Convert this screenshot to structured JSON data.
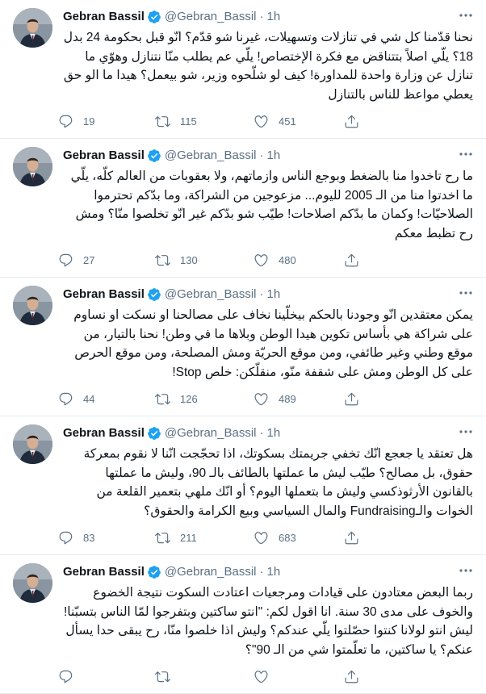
{
  "tweets": [
    {
      "name": "Gebran Bassil",
      "handle": "@Gebran_Bassil",
      "dot": "·",
      "time": "1h",
      "text": "نحنا قدّمنا كل شي في تنازلات وتسهيلات، غيرنا شو قدّم؟ انّو قبل بحكومة 24 بدل 18؟ يلّي اصلاً بتتناقض مع فكرة الإختصاص! يلّي عم يطلب منّا نتنازل وهوّي ما تنازل عن وزارة واحدة للمداورة! كيف لو شلّحوه وزير، شو بيعمل؟ هيدا ما الو حق يعطي مواعظ للناس بالتنازل",
      "replies": "19",
      "retweets": "115",
      "likes": "451"
    },
    {
      "name": "Gebran Bassil",
      "handle": "@Gebran_Bassil",
      "dot": "·",
      "time": "1h",
      "text": "ما رح تاخدوا منا بالضغط وبوجع الناس وازماتهم، ولا بعقوبات من العالم كلّه، يلّي ما اخدتوا منا من الـ 2005 لليوم... مزعوجين من الشراكة، وما بدّكم تحترموا الصلاحيّات! وكمان ما بدّكم اصلاحات! طيّب شو بدّكم غير انّو تخلصوا منّا؟ ومش رح تظبط معكم",
      "replies": "27",
      "retweets": "130",
      "likes": "480"
    },
    {
      "name": "Gebran Bassil",
      "handle": "@Gebran_Bassil",
      "dot": "·",
      "time": "1h",
      "text": "يمكن معتقدين انّو وجودنا بالحكم بيخلّينا نخاف على مصالحنا او نسكت او نساوم على شراكة هي بأساس تكوين هيدا الوطن وبلاها ما في وطن! نحنا بالتيار، من موقع وطني وغير طائفي، ومن موقع الحريّة ومش المصلحة، ومن موقع الحرص على كل الوطن ومش على شقفة منّو، منقلّكن: خلص Stop!",
      "replies": "44",
      "retweets": "126",
      "likes": "489"
    },
    {
      "name": "Gebran Bassil",
      "handle": "@Gebran_Bassil",
      "dot": "·",
      "time": "1h",
      "text": "هل تعتقد يا جعجع انّك تخفي جريمتك بسكوتك، اذا تحجّجت انّنا لا نقوم بمعركة حقوق، بل مصالح؟ طيّب ليش ما عملتها بالطائف بالـ 90، وليش ما عملتها بالقانون الأرثوذكسي وليش ما بتعملها اليوم؟ أو انّك ملهي بتعمير القلعة من الخوات والـFundraising والمال السياسي وبيع الكرامة والحقوق؟",
      "replies": "83",
      "retweets": "211",
      "likes": "683"
    },
    {
      "name": "Gebran Bassil",
      "handle": "@Gebran_Bassil",
      "dot": "·",
      "time": "1h",
      "text": "ربما البعض معتادون على قيادات ومرجعيات اعتادت السكوت نتيجة الخضوع والخوف على مدى 30 سنة. انا اقول لكم: \"انتو ساكتين وبتفرجوا لمّا الناس بتسبّنا! ليش انتو لولانا كنتوا حصّلتوا يلّي عندكم؟ وليش اذا خلصوا منّا، رح يبقى حدا يسأل عنكم؟ يا ساكتين، ما تعلّمتوا شي من الـ 90\"؟",
      "replies": "",
      "retweets": "",
      "likes": ""
    }
  ],
  "colors": {
    "text": "#0f1419",
    "secondary": "#5b7083",
    "verified": "#1da1f2",
    "divider": "#e6ecf0"
  },
  "icons": {
    "avatar": "profile-photo",
    "verified": "verified-badge-icon",
    "more": "more-dots-icon",
    "reply": "reply-icon",
    "retweet": "retweet-icon",
    "like": "heart-icon",
    "share": "share-icon"
  }
}
